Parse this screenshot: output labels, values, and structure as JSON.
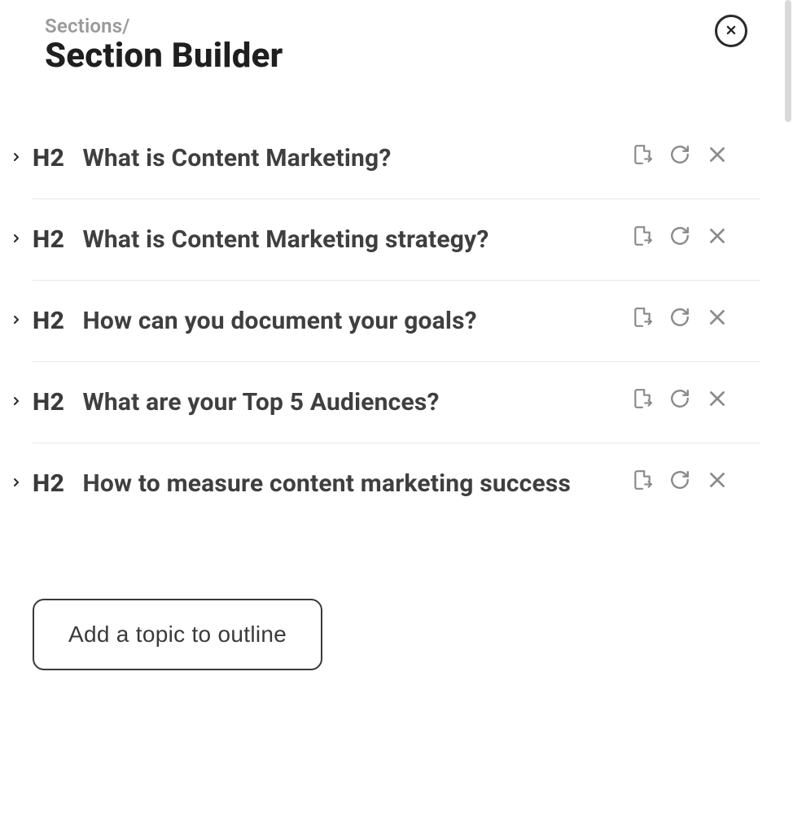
{
  "header": {
    "breadcrumb": "Sections/",
    "title": "Section Builder"
  },
  "sections": [
    {
      "level": "H2",
      "title": "What is Content Marketing?"
    },
    {
      "level": "H2",
      "title": "What is Content Marketing strategy?"
    },
    {
      "level": "H2",
      "title": "How can you document your goals?"
    },
    {
      "level": "H2",
      "title": "What are your Top 5 Audiences?"
    },
    {
      "level": "H2",
      "title": "How to measure content marketing success"
    }
  ],
  "buttons": {
    "add_topic": "Add a topic to outline"
  }
}
